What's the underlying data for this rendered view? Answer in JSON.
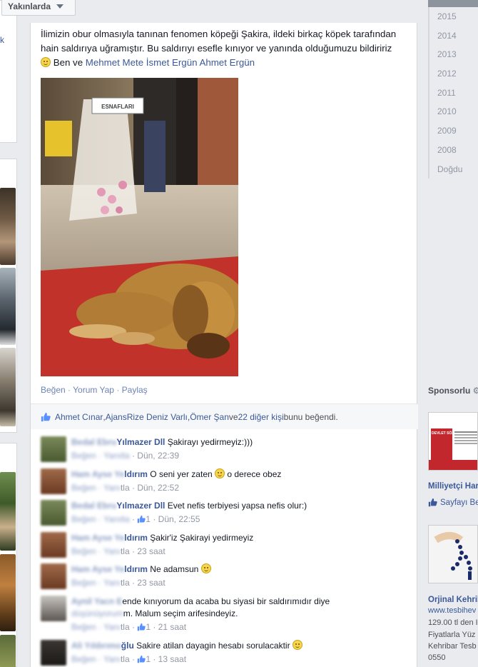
{
  "filter": {
    "label": "Yakınlarda"
  },
  "left": {
    "stub_text": "k"
  },
  "post": {
    "text_main": "İlimizin obur olmasıyla tanınan fenomen köpeği Şakira, ildeki birkaç köpek tarafından hain saldırıya uğramıştır. Bu saldırıyı esefle kınıyor ve yanında olduğumuzu bildiririz ",
    "text_with": " Ben ve ",
    "tag1": "Mehmet Mete",
    "tag2": "İsmet Ergün",
    "tag3": "Ahmet Ergün",
    "photo_banner": "ESNAFLARI",
    "actions": {
      "like": "Beğen",
      "comment": "Yorum Yap",
      "share": "Paylaş",
      "sep": " · "
    },
    "likes": {
      "p1": "Ahmet Cınar",
      "p2": "AjansRize Deniz Varlı",
      "p3": "Ömer Şan",
      "connector": " ve ",
      "others": "22 diğer kişi",
      "suffix": " bunu beğendi.",
      "comma": ", "
    }
  },
  "comments": [
    {
      "blur_name": "Bedal Ebru",
      "name": "Yılmazer Dll",
      "text": " Şakirayı yedirmeyiz:)))",
      "blur_meta": "Beğen · Yanıtla",
      "likes": "",
      "time": "Dün, 22:39"
    },
    {
      "blur_name": "Ham Ayse Ye",
      "name": "ldırım",
      "text": " O seni yer zaten ",
      "text2": " o derece obez",
      "blur_meta": "Beğen · Yanı",
      "tail": "tla",
      "likes": "",
      "time": "Dün, 22:52"
    },
    {
      "blur_name": "Bedal Ebru",
      "name": "Yılmazer Dll",
      "text": " Evet nefis terbiyesi yapsa nefis olur:)",
      "blur_meta": "Beğen · Yanıtla",
      "likes": "1",
      "time": "Dün, 22:55"
    },
    {
      "blur_name": "Ham Ayse Ye",
      "name": "ldırım",
      "text": " Şakir'iz Şakirayi yedirmeyiz",
      "blur_meta": "Beğen · Yanı",
      "tail": "tla",
      "likes": "",
      "time": "23 saat"
    },
    {
      "blur_name": "Ham Ayse Ye",
      "name": "ldırım",
      "text": " Ne adamsun ",
      "blur_meta": "Beğen · Yanı",
      "tail": "tla",
      "likes": "",
      "time": "23 saat"
    },
    {
      "blur_name": "Aynil Yacn E",
      "text": "ende kınıyorum da acaba bu siyasi bir saldırımıdır diye",
      "line2_blur": "düşünüyorum",
      "line2": "m. Malum seçim arifesindeyiz.",
      "blur_meta": "Beğen · Yanı",
      "tail": "tla",
      "likes": "1",
      "time": "21 saat"
    },
    {
      "blur_name": "Ali Yıldırımo",
      "name": "ğlu",
      "text": " Sakire atilan dayagin hesabı sorulacaktir ",
      "blur_meta": "Beğen · Yanı",
      "tail": "tla",
      "likes": "1",
      "time": "13 saat"
    }
  ],
  "timeline": {
    "years": [
      "2015",
      "2014",
      "2013",
      "2012",
      "2011",
      "2010",
      "2009",
      "2008",
      "Doğdu"
    ]
  },
  "sponsored": {
    "title": "Sponsorlu",
    "ad1": {
      "img_text": "DEVLET SÖZÜ",
      "title": "Milliyetçi Har",
      "like": "Sayfayı Be"
    },
    "ad2": {
      "title": "Orjinal Kehrib",
      "link": "www.tesbihev",
      "line1": "129.00 tl den I",
      "line2": "Fiyatlarla Yüz",
      "line3": "Kehribar Tesb",
      "line4": "0550"
    }
  },
  "colors": {
    "link": "#3b5998",
    "meta": "#9197a3",
    "bg": "#e9ebee"
  }
}
